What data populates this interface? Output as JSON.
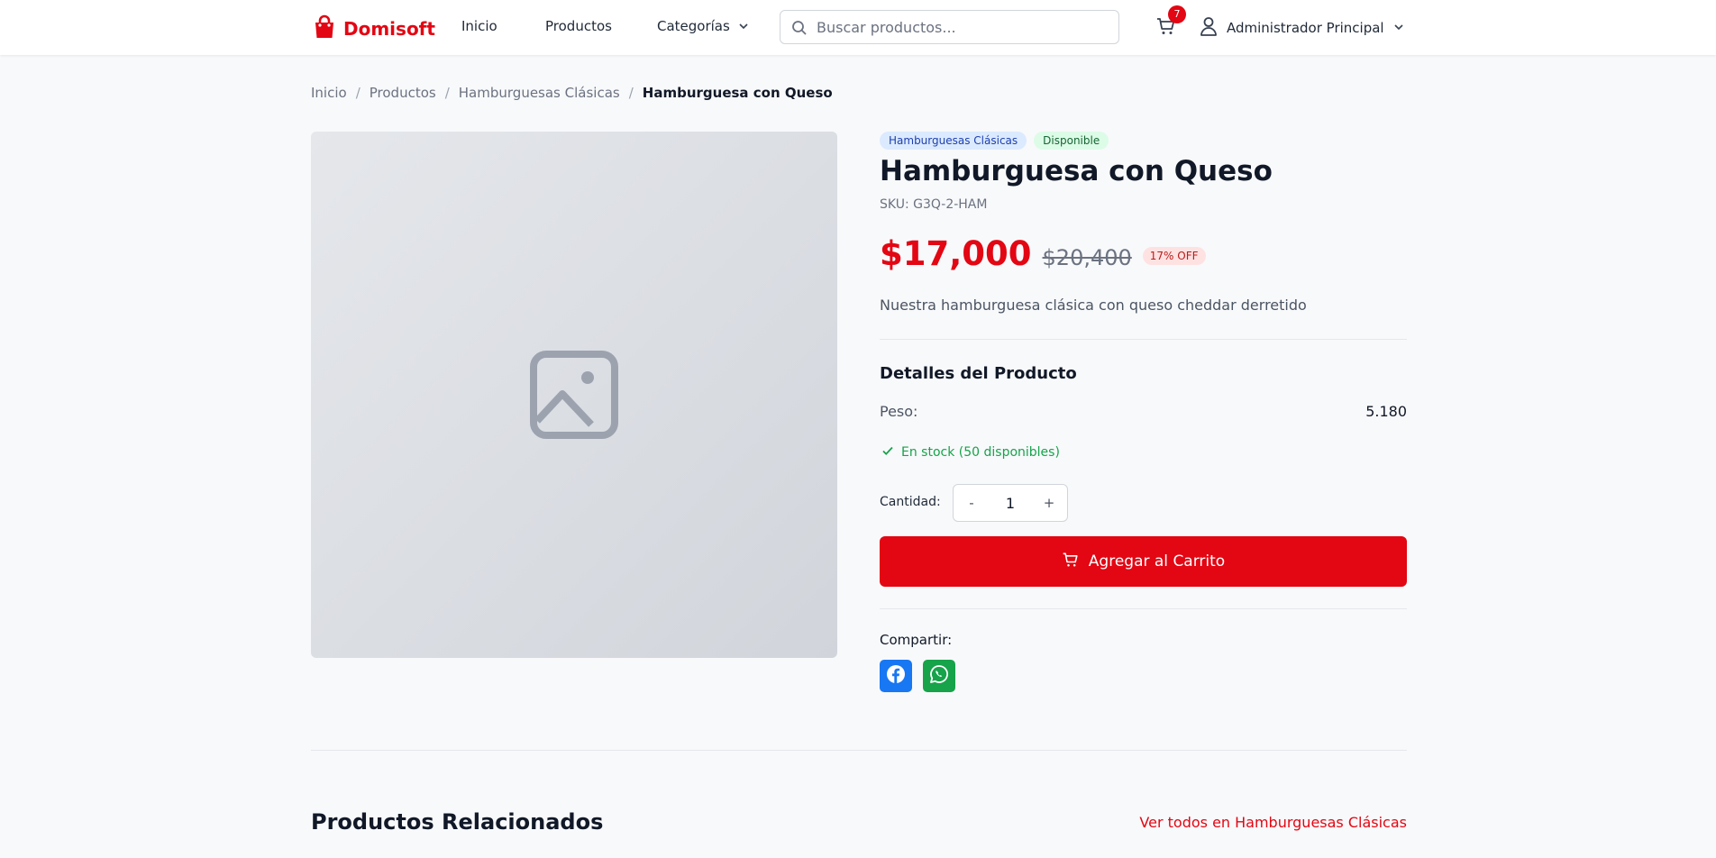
{
  "header": {
    "brand": "Domisoft",
    "nav": {
      "home": "Inicio",
      "products": "Productos",
      "categories": "Categorías"
    },
    "search_placeholder": "Buscar productos...",
    "cart_count": "7",
    "user_name": "Administrador Principal"
  },
  "breadcrumb": [
    "Inicio",
    "Productos",
    "Hamburguesas Clásicas",
    "Hamburguesa con Queso"
  ],
  "product": {
    "category_badge": "Hamburguesas Clásicas",
    "status_badge": "Disponible",
    "title": "Hamburguesa con Queso",
    "sku": "SKU: G3Q-2-HAM",
    "price": "$17,000",
    "old_price": "$20,400",
    "discount": "17% OFF",
    "description": "Nuestra hamburguesa clásica con queso cheddar derretido",
    "details_title": "Detalles del Producto",
    "weight_label": "Peso:",
    "weight_value": "5.180",
    "stock_text": "En stock (50 disponibles)",
    "quantity_label": "Cantidad:",
    "quantity_minus": "-",
    "quantity_value": "1",
    "quantity_plus": "+",
    "add_to_cart": "Agregar al Carrito",
    "share_label": "Compartir:"
  },
  "related": {
    "title": "Productos Relacionados",
    "view_all": "Ver todos en Hamburguesas Clásicas"
  },
  "colors": {
    "brand": "#e30613",
    "facebook": "#1877f2",
    "whatsapp": "#16a34a",
    "stock": "#16a34a"
  },
  "icons": [
    "shopping-bag-icon",
    "chevron-down-icon",
    "search-icon",
    "cart-icon",
    "user-icon",
    "image-placeholder-icon",
    "check-icon",
    "facebook-icon",
    "whatsapp-icon"
  ]
}
